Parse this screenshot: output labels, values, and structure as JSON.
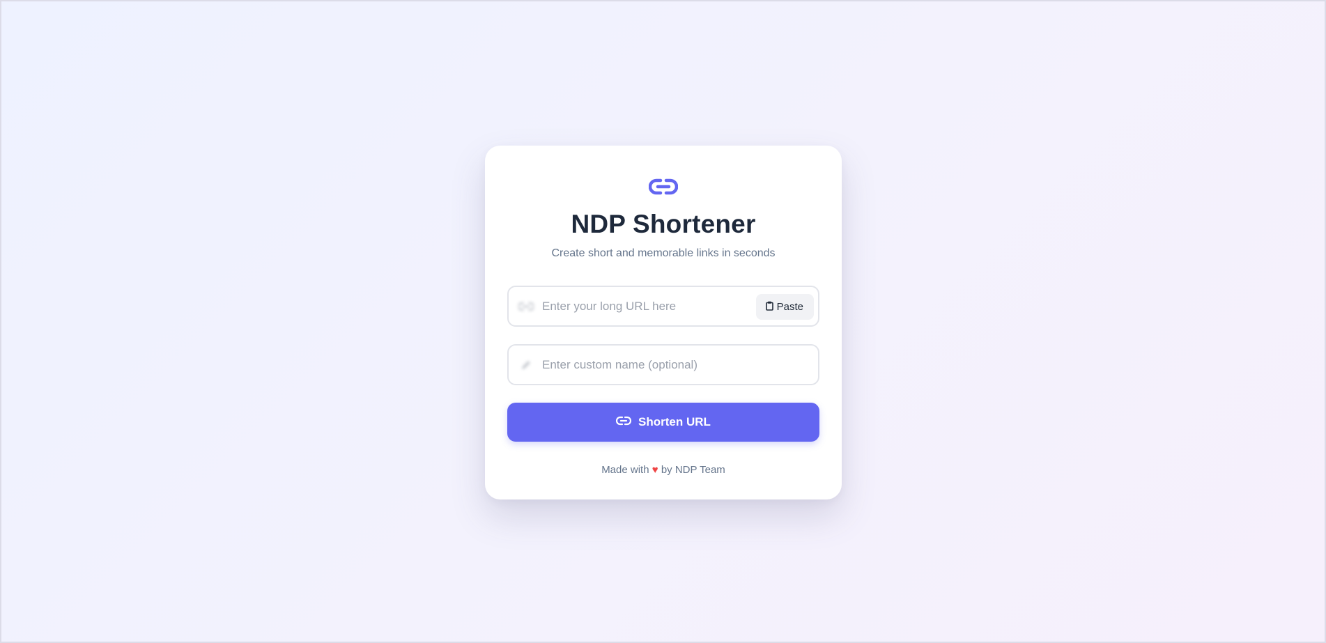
{
  "app": {
    "title": "NDP Shortener",
    "subtitle": "Create short and memorable links in seconds",
    "logo_icon": "link-icon",
    "accent_color": "#6366f1"
  },
  "url_field": {
    "placeholder": "Enter your long URL here",
    "value": "",
    "icon": "link-icon",
    "paste_label": "Paste",
    "paste_icon": "clipboard-icon"
  },
  "name_field": {
    "placeholder": "Enter custom name (optional)",
    "value": "",
    "icon": "pencil-icon"
  },
  "shorten_button": {
    "label": "Shorten URL",
    "icon": "link-icon"
  },
  "footer": {
    "before": "Made with",
    "heart": "♥",
    "after": "by NDP Team",
    "heart_color": "#ef4444"
  }
}
